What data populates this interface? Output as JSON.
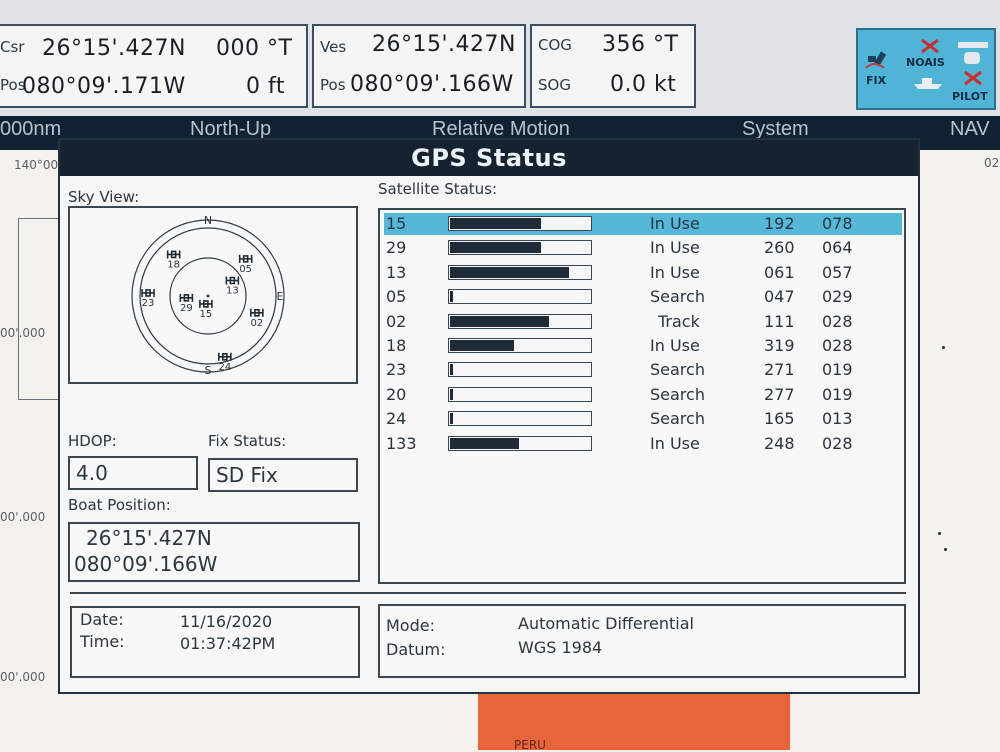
{
  "topbar": {
    "cursor": {
      "label": "Csr",
      "pos_label": "Pos",
      "lat": "26°15'.427N",
      "lon": "080°09'.171W",
      "bearing": "000 °T",
      "range": "0 ft"
    },
    "vessel": {
      "label": "Ves",
      "pos_label": "Pos",
      "lat": "26°15'.427N",
      "lon": "080°09'.166W"
    },
    "course": {
      "cog_label": "COG",
      "cog_value": "356 °T",
      "sog_label": "SOG",
      "sog_value": "0.0 kt"
    },
    "icons": {
      "fix_label": "FIX",
      "noais_label": "NOAIS",
      "pilot_label": "PILOT"
    }
  },
  "chart_header": {
    "range": "000nm",
    "orientation": "North-Up",
    "motion": "Relative Motion",
    "system": "System",
    "nav": "NAV"
  },
  "chart_labels": {
    "lat_140": "140°00'",
    "lat_a": "00'.000",
    "lat_b": "00'.000",
    "lat_c": "00'.000",
    "land_text": "PERU",
    "edge_num": "02"
  },
  "dialog": {
    "title": "GPS Status",
    "sky_view_label": "Sky View:",
    "satellite_status_label": "Satellite Status:",
    "hdop_label": "HDOP:",
    "hdop_value": "4.0",
    "fix_status_label": "Fix Status:",
    "fix_status_value": "SD Fix",
    "boat_position_label": "Boat Position:",
    "boat_lat": "26°15'.427N",
    "boat_lon": "080°09'.166W",
    "date_label": "Date:",
    "date_value": "11/16/2020",
    "time_label": "Time:",
    "time_value": "01:37:42PM",
    "mode_label": "Mode:",
    "mode_value": "Automatic Differential",
    "datum_label": "Datum:",
    "datum_value": "WGS 1984"
  },
  "sky": {
    "compass": {
      "n": "N",
      "e": "E",
      "s": "S"
    },
    "satellites": [
      {
        "id": "18",
        "az": 319,
        "el": 28
      },
      {
        "id": "05",
        "az": 47,
        "el": 29
      },
      {
        "id": "13",
        "az": 61,
        "el": 57
      },
      {
        "id": "23",
        "az": 271,
        "el": 19
      },
      {
        "id": "29",
        "az": 260,
        "el": 64
      },
      {
        "id": "15",
        "az": 192,
        "el": 78
      },
      {
        "id": "02",
        "az": 111,
        "el": 28
      },
      {
        "id": "24",
        "az": 165,
        "el": 13
      }
    ]
  },
  "satellites": [
    {
      "prn": "15",
      "signal": 0.65,
      "status": "In Use",
      "azimuth": "192",
      "elevation": "078",
      "selected": true
    },
    {
      "prn": "29",
      "signal": 0.65,
      "status": "In Use",
      "azimuth": "260",
      "elevation": "064",
      "selected": false
    },
    {
      "prn": "13",
      "signal": 0.85,
      "status": "In Use",
      "azimuth": "061",
      "elevation": "057",
      "selected": false
    },
    {
      "prn": "05",
      "signal": 0.02,
      "status": "Search",
      "azimuth": "047",
      "elevation": "029",
      "selected": false
    },
    {
      "prn": "02",
      "signal": 0.71,
      "status": "Track",
      "azimuth": "111",
      "elevation": "028",
      "selected": false
    },
    {
      "prn": "18",
      "signal": 0.46,
      "status": "In Use",
      "azimuth": "319",
      "elevation": "028",
      "selected": false
    },
    {
      "prn": "23",
      "signal": 0.02,
      "status": "Search",
      "azimuth": "271",
      "elevation": "019",
      "selected": false
    },
    {
      "prn": "20",
      "signal": 0.02,
      "status": "Search",
      "azimuth": "277",
      "elevation": "019",
      "selected": false
    },
    {
      "prn": "24",
      "signal": 0.02,
      "status": "Search",
      "azimuth": "165",
      "elevation": "013",
      "selected": false
    },
    {
      "prn": "133",
      "signal": 0.49,
      "status": "In Use",
      "azimuth": "248",
      "elevation": "028",
      "selected": false
    }
  ],
  "colors": {
    "selected_row": "#55b8d8",
    "title_bar": "#15222f",
    "land": "#e8643a",
    "icon_panel": "#4fb4d6"
  }
}
